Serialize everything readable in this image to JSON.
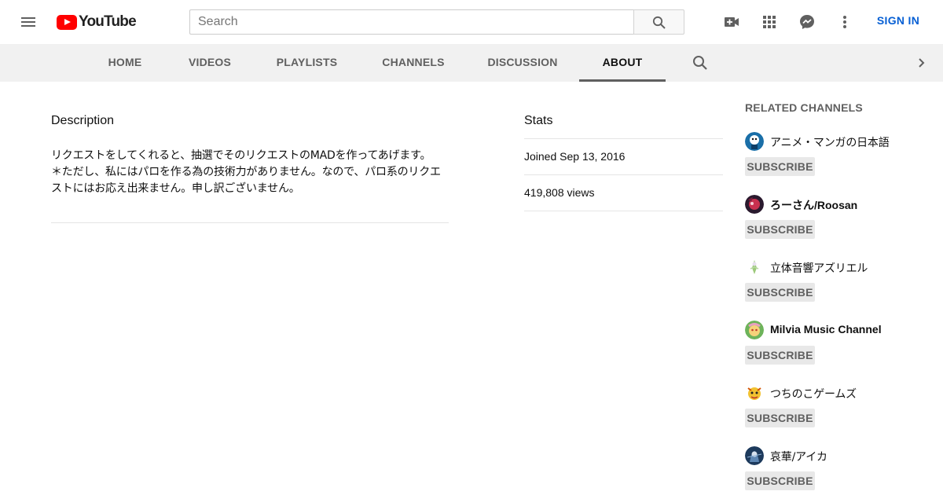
{
  "masthead": {
    "logo_text": "YouTube",
    "search_placeholder": "Search",
    "sign_in_label": "SIGN IN",
    "icons": [
      "menu-icon",
      "search-icon",
      "create-video-icon",
      "apps-icon",
      "messages-icon",
      "more-vert-icon"
    ]
  },
  "tabs": [
    {
      "label": "HOME"
    },
    {
      "label": "VIDEOS"
    },
    {
      "label": "PLAYLISTS"
    },
    {
      "label": "CHANNELS"
    },
    {
      "label": "DISCUSSION"
    },
    {
      "label": "ABOUT",
      "active": true
    }
  ],
  "description": {
    "title": "Description",
    "text": "リクエストをしてくれると、抽選でそのリクエストのMADを作ってあげます。\n＊ただし、私にはパロを作る為の技術力がありません。なので、パロ系のリクエストにはお応え出来ません。申し訳ございません。"
  },
  "stats": {
    "title": "Stats",
    "joined": "Joined Sep 13, 2016",
    "views": "419,808 views"
  },
  "related": {
    "title": "RELATED CHANNELS",
    "subscribe_label": "SUBSCRIBE",
    "channels": [
      {
        "name": "アニメ・マンガの日本語"
      },
      {
        "name": "ろーさん/Roosan"
      },
      {
        "name": "立体音響アズリエル"
      },
      {
        "name": "Milvia Music Channel"
      },
      {
        "name": "つちのこゲームズ"
      },
      {
        "name": "哀華/アイカ"
      }
    ]
  },
  "colors": {
    "brand_red": "#ff0000",
    "link_blue": "#065fd4",
    "tab_bar_bg": "#f1f1f1",
    "subscribe_bg": "#e8e8e8"
  }
}
